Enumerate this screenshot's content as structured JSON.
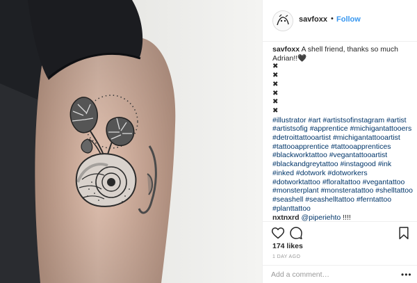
{
  "post": {
    "username": "savfoxx",
    "header_separator": "•",
    "follow_label": "Follow",
    "caption_text": "A shell friend, thanks so much Adrian!!🖤",
    "caption_marks": [
      "✖",
      "✖",
      "✖",
      "✖",
      "✖",
      "✖"
    ],
    "hashtags": [
      "#illustrator",
      "#art",
      "#artistsofinstagram",
      "#artist",
      "#artistsofig",
      "#apprentice",
      "#michigantattooers",
      "#detroittattooartist",
      "#michigantattooartist",
      "#tattooapprentice",
      "#tattooapprentices",
      "#blackworktattoo",
      "#vegantattooartist",
      "#blackandgreytattoo",
      "#instagood",
      "#ink",
      "#inked",
      "#dotwork",
      "#dotworkers",
      "#dotworktattoo",
      "#floraltattoo",
      "#vegantattoo",
      "#monsterplant",
      "#monsteratattoo",
      "#shelltattoo",
      "#seashell",
      "#seashelltattoo",
      "#ferntattoo",
      "#planttattoo"
    ],
    "comment": {
      "username": "nxtnxrd",
      "mention": "@piperiehto",
      "text": " !!!!"
    },
    "likes": "174 likes",
    "timestamp": "1 DAY AGO",
    "add_comment_placeholder": "Add a comment…",
    "more_label": "•••"
  },
  "icons": {
    "avatar": "avatar-illustration-icon",
    "like": "heart-outline-icon",
    "comment": "speech-bubble-icon",
    "save": "bookmark-icon",
    "more": "more-options-icon"
  },
  "colors": {
    "link": "#3897f0",
    "hashtag": "#003569",
    "text": "#262626",
    "muted": "#999999",
    "border": "#efefef"
  }
}
